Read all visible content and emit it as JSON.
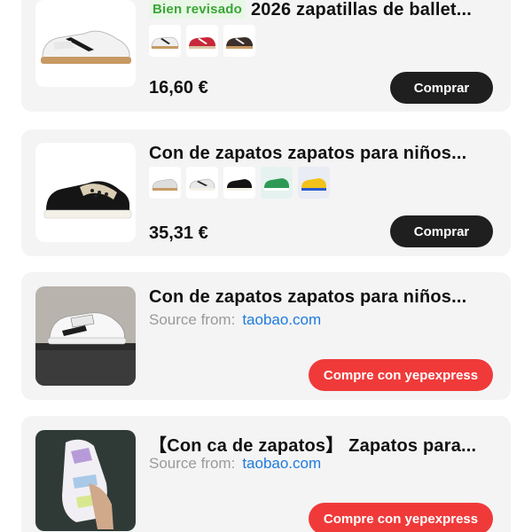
{
  "products": [
    {
      "badge": "Bien revisado",
      "title": "2026 zapatillas de ballet...",
      "price": "16,60 €",
      "button": "Comprar"
    },
    {
      "title": "Con de zapatos zapatos para niños...",
      "price": "35,31 €",
      "button": "Comprar"
    },
    {
      "title": "Con de zapatos zapatos para niños...",
      "source_label": "Source from:",
      "source_link": "taobao.com",
      "button": "Compre con yepexpress"
    },
    {
      "title": "【Con ca de zapatos】 Zapatos para...",
      "source_label": "Source from:",
      "source_link": "taobao.com",
      "button": "Compre con yepexpress"
    }
  ],
  "colors": {
    "card_bg": "#f4f4f5",
    "dark_button": "#1f1f1f",
    "red_button": "#f03a3a",
    "badge_green": "#3aa637",
    "link_blue": "#1e7bdc"
  }
}
